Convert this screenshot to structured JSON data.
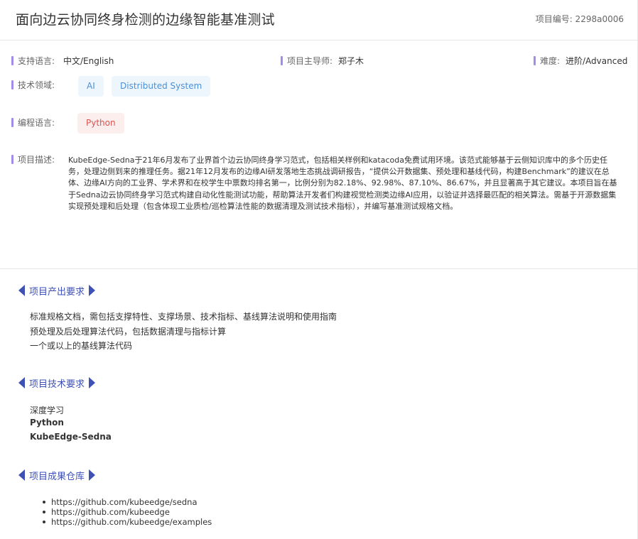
{
  "header": {
    "title": "面向边云协同终身检测的边缘智能基准测试",
    "project_id": "项目编号: 2298a0006"
  },
  "info": {
    "language_label": "支持语言:",
    "language_value": "中文/English",
    "mentor_label": "项目主导师:",
    "mentor_value": "郑子木",
    "difficulty_label": "难度:",
    "difficulty_value": "进阶/Advanced",
    "tech_label": "技术领域:",
    "tech_tags": [
      "AI",
      "Distributed System"
    ],
    "prog_label": "编程语言:",
    "prog_tags": [
      "Python"
    ],
    "desc_label": "项目描述:",
    "description": "KubeEdge-Sedna于21年6月发布了业界首个边云协同终身学习范式，包括相关样例和katacoda免费试用环境。该范式能够基于云侧知识库中的多个历史任务，处理边侧到来的推理任务。据21年12月发布的边缘AI研发落地生态挑战调研报告，“提供公开数据集、预处理和基线代码，构建Benchmark”的建议在总体、边缘AI方向的工业界、学术界和在校学生中票数均排名第一，比例分别为82.18%、92.98%、87.10%、86.67%，并且显著高于其它建议。本项目旨在基于Sedna边云协同终身学习范式构建自动化性能测试功能，帮助算法开发者们构建视觉检测类边缘AI应用，以验证并选择最匹配的相关算法。需基于开源数据集实现预处理和后处理（包含体现工业质检/巡检算法性能的数据清理及测试技术指标），并编写基准测试规格文档。"
  },
  "sections": {
    "output": {
      "title": "项目产出要求",
      "items": [
        "标准规格文档，需包括支撑特性、支撑场景、技术指标、基线算法说明和使用指南",
        "预处理及后处理算法代码，包括数据清理与指标计算",
        "一个或以上的基线算法代码"
      ]
    },
    "tech": {
      "title": "项目技术要求",
      "items": [
        "深度学习",
        "Python",
        "KubeEdge-Sedna"
      ]
    },
    "repo": {
      "title": "项目成果仓库",
      "links": [
        "https://github.com/kubeedge/sedna",
        "https://github.com/kubeedge",
        "https://github.com/kubeedge/examples"
      ]
    }
  },
  "colors": {
    "accent": "#3f51b5",
    "label_bar": "#a28ce8",
    "tag_blue_bg": "#eef6fd",
    "tag_blue_text": "#4a90d9",
    "tag_red_bg": "#fdeeee",
    "tag_red_text": "#d9534f"
  },
  "icons": {
    "section_marker_left": "triangle-left-icon",
    "section_marker_right": "triangle-right-icon"
  }
}
